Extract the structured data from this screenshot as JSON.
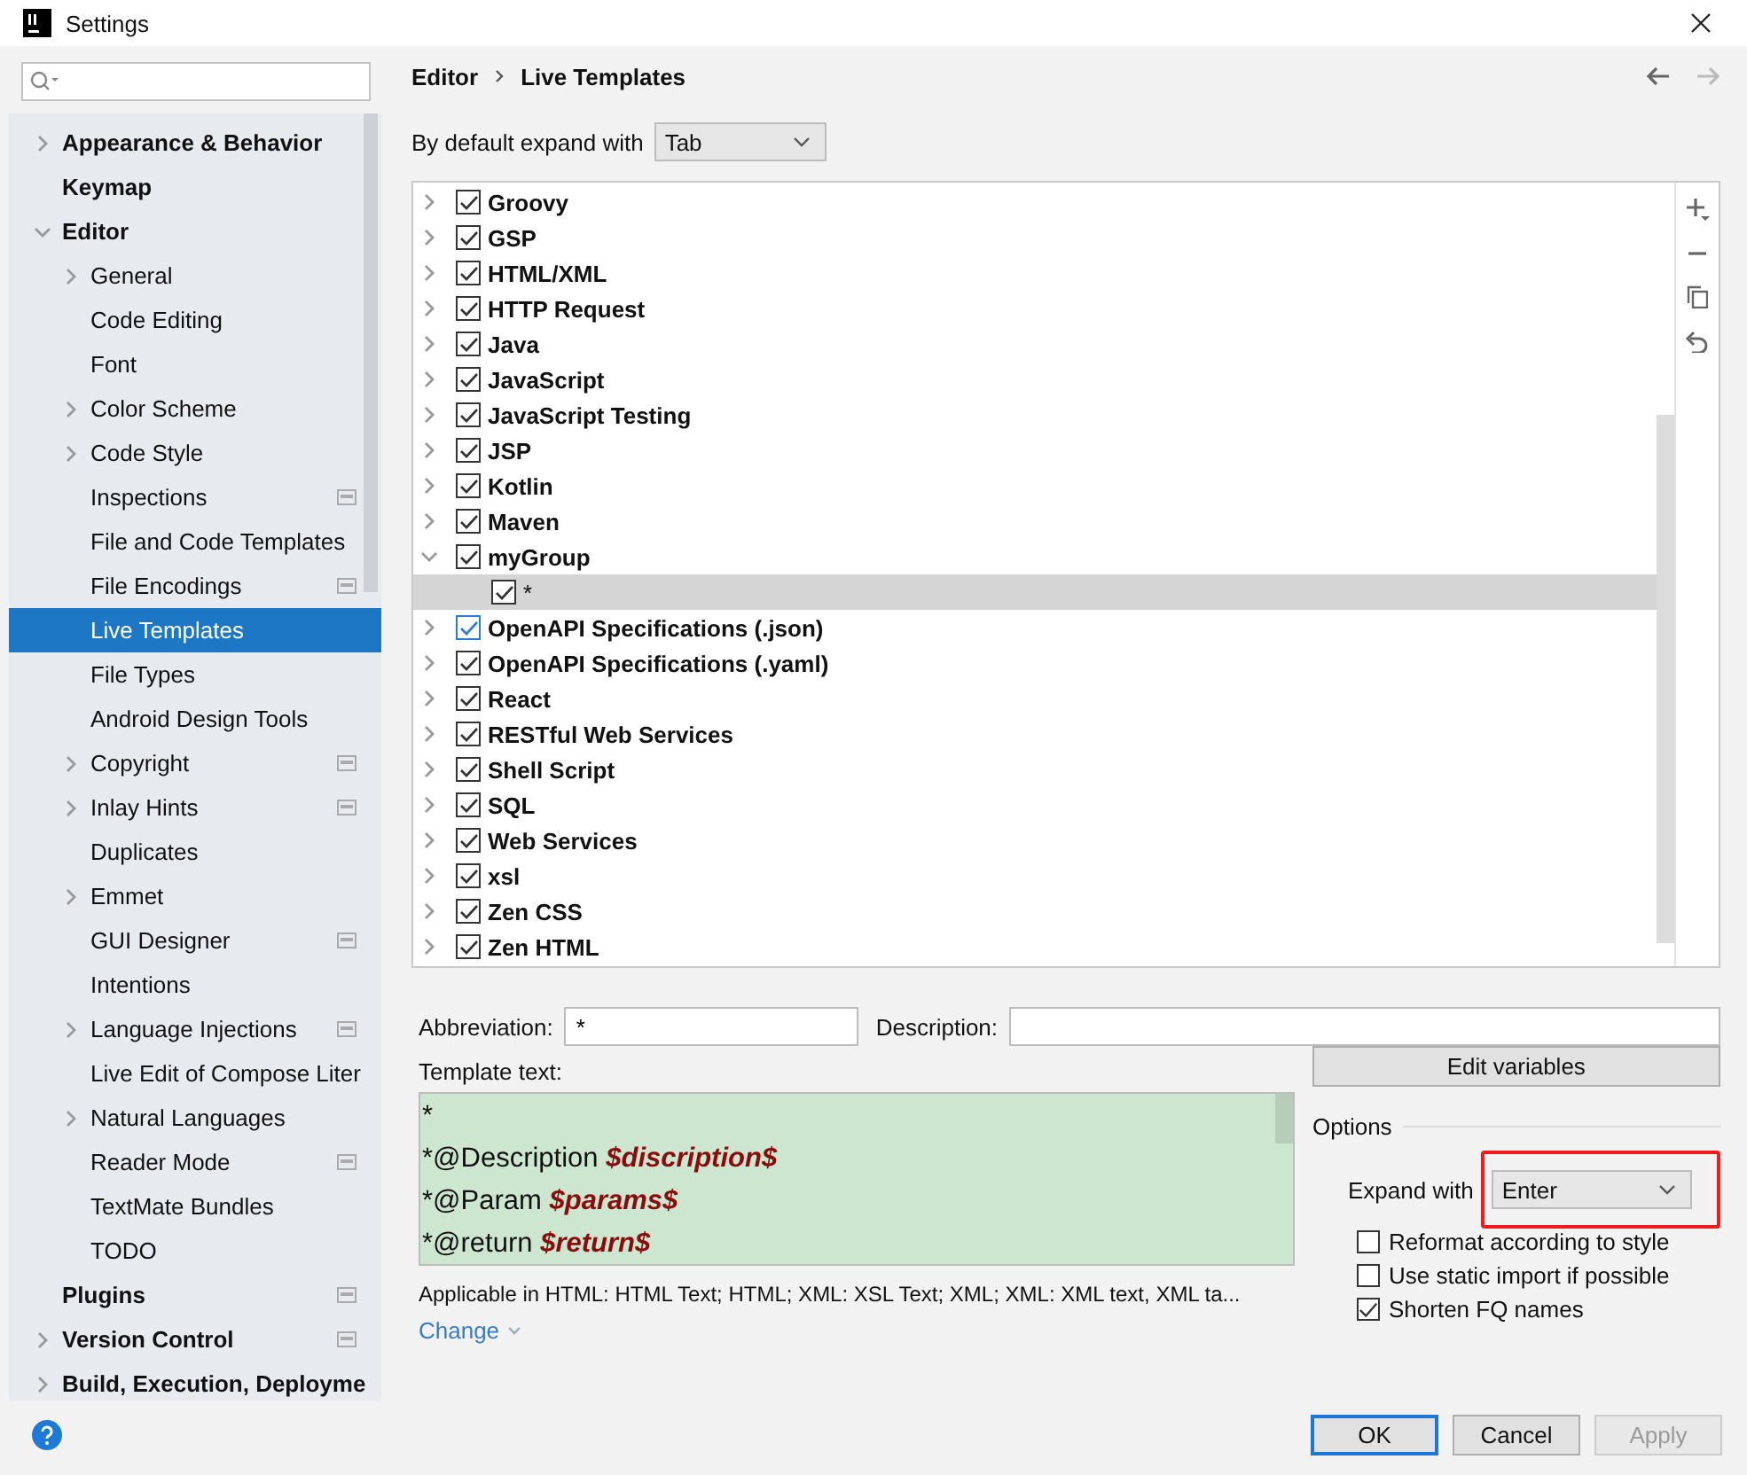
{
  "window": {
    "title": "Settings"
  },
  "sidebar": {
    "items": [
      {
        "label": "Appearance & Behavior",
        "expandable": true,
        "expanded": false,
        "selected": false,
        "project_icon": false
      },
      {
        "label": "Keymap",
        "expandable": false,
        "selected": false,
        "project_icon": false
      },
      {
        "label": "Editor",
        "expandable": true,
        "expanded": true,
        "selected": false,
        "project_icon": false,
        "children": [
          {
            "label": "General",
            "expandable": true,
            "expanded": false,
            "selected": false,
            "project_icon": false
          },
          {
            "label": "Code Editing",
            "expandable": false,
            "selected": false,
            "project_icon": false
          },
          {
            "label": "Font",
            "expandable": false,
            "selected": false,
            "project_icon": false
          },
          {
            "label": "Color Scheme",
            "expandable": true,
            "expanded": false,
            "selected": false,
            "project_icon": false
          },
          {
            "label": "Code Style",
            "expandable": true,
            "expanded": false,
            "selected": false,
            "project_icon": false
          },
          {
            "label": "Inspections",
            "expandable": false,
            "selected": false,
            "project_icon": true
          },
          {
            "label": "File and Code Templates",
            "expandable": false,
            "selected": false,
            "project_icon": false
          },
          {
            "label": "File Encodings",
            "expandable": false,
            "selected": false,
            "project_icon": true
          },
          {
            "label": "Live Templates",
            "expandable": false,
            "selected": true,
            "project_icon": false
          },
          {
            "label": "File Types",
            "expandable": false,
            "selected": false,
            "project_icon": false
          },
          {
            "label": "Android Design Tools",
            "expandable": false,
            "selected": false,
            "project_icon": false
          },
          {
            "label": "Copyright",
            "expandable": true,
            "expanded": false,
            "selected": false,
            "project_icon": true
          },
          {
            "label": "Inlay Hints",
            "expandable": true,
            "expanded": false,
            "selected": false,
            "project_icon": true
          },
          {
            "label": "Duplicates",
            "expandable": false,
            "selected": false,
            "project_icon": false
          },
          {
            "label": "Emmet",
            "expandable": true,
            "expanded": false,
            "selected": false,
            "project_icon": false
          },
          {
            "label": "GUI Designer",
            "expandable": false,
            "selected": false,
            "project_icon": true
          },
          {
            "label": "Intentions",
            "expandable": false,
            "selected": false,
            "project_icon": false
          },
          {
            "label": "Language Injections",
            "expandable": true,
            "expanded": false,
            "selected": false,
            "project_icon": true
          },
          {
            "label": "Live Edit of Compose Liter",
            "expandable": false,
            "selected": false,
            "project_icon": false
          },
          {
            "label": "Natural Languages",
            "expandable": true,
            "expanded": false,
            "selected": false,
            "project_icon": false
          },
          {
            "label": "Reader Mode",
            "expandable": false,
            "selected": false,
            "project_icon": true
          },
          {
            "label": "TextMate Bundles",
            "expandable": false,
            "selected": false,
            "project_icon": false
          },
          {
            "label": "TODO",
            "expandable": false,
            "selected": false,
            "project_icon": false
          }
        ]
      },
      {
        "label": "Plugins",
        "expandable": false,
        "selected": false,
        "project_icon": true
      },
      {
        "label": "Version Control",
        "expandable": true,
        "expanded": false,
        "selected": false,
        "project_icon": true
      },
      {
        "label": "Build, Execution, Deployme",
        "expandable": true,
        "expanded": false,
        "selected": false,
        "project_icon": false
      }
    ]
  },
  "breadcrumb": [
    "Editor",
    "Live Templates"
  ],
  "default_expand": {
    "label": "By default expand with",
    "value": "Tab"
  },
  "templates": [
    {
      "name": "Groovy",
      "checked": true,
      "expanded": false,
      "selected": false
    },
    {
      "name": "GSP",
      "checked": true,
      "expanded": false,
      "selected": false
    },
    {
      "name": "HTML/XML",
      "checked": true,
      "expanded": false,
      "selected": false
    },
    {
      "name": "HTTP Request",
      "checked": true,
      "expanded": false,
      "selected": false
    },
    {
      "name": "Java",
      "checked": true,
      "expanded": false,
      "selected": false
    },
    {
      "name": "JavaScript",
      "checked": true,
      "expanded": false,
      "selected": false
    },
    {
      "name": "JavaScript Testing",
      "checked": true,
      "expanded": false,
      "selected": false
    },
    {
      "name": "JSP",
      "checked": true,
      "expanded": false,
      "selected": false
    },
    {
      "name": "Kotlin",
      "checked": true,
      "expanded": false,
      "selected": false
    },
    {
      "name": "Maven",
      "checked": true,
      "expanded": false,
      "selected": false
    },
    {
      "name": "myGroup",
      "checked": true,
      "expanded": true,
      "selected": false,
      "children": [
        {
          "name": "*",
          "checked": true,
          "selected": true
        }
      ]
    },
    {
      "name": "OpenAPI Specifications (.json)",
      "checked": true,
      "expanded": false,
      "selected": false,
      "focused": true
    },
    {
      "name": "OpenAPI Specifications (.yaml)",
      "checked": true,
      "expanded": false,
      "selected": false
    },
    {
      "name": "React",
      "checked": true,
      "expanded": false,
      "selected": false
    },
    {
      "name": "RESTful Web Services",
      "checked": true,
      "expanded": false,
      "selected": false
    },
    {
      "name": "Shell Script",
      "checked": true,
      "expanded": false,
      "selected": false
    },
    {
      "name": "SQL",
      "checked": true,
      "expanded": false,
      "selected": false
    },
    {
      "name": "Web Services",
      "checked": true,
      "expanded": false,
      "selected": false
    },
    {
      "name": "xsl",
      "checked": true,
      "expanded": false,
      "selected": false
    },
    {
      "name": "Zen CSS",
      "checked": true,
      "expanded": false,
      "selected": false
    },
    {
      "name": "Zen HTML",
      "checked": true,
      "expanded": false,
      "selected": false
    }
  ],
  "abbreviation": {
    "label": "Abbreviation:",
    "value": "*"
  },
  "description": {
    "label": "Description:"
  },
  "template_text": {
    "label": "Template text:",
    "lines": [
      {
        "text": "*"
      },
      {
        "text": "*@Description ",
        "variable": "$discription$"
      },
      {
        "text": "*@Param ",
        "variable": "$params$"
      },
      {
        "text": "*@return ",
        "variable": "$return$"
      }
    ]
  },
  "applicable": "Applicable in HTML: HTML Text; HTML; XML: XSL Text; XML; XML: XML text, XML ta...",
  "change_link": "Change",
  "edit_variables": "Edit variables",
  "options": {
    "title": "Options",
    "expand_label": "Expand with",
    "expand_value": "Enter",
    "highlighted": true,
    "checkboxes": [
      {
        "label": "Reformat according to style",
        "checked": false
      },
      {
        "label": "Use static import if possible",
        "checked": false
      },
      {
        "label": "Shorten FQ names",
        "checked": true
      }
    ]
  },
  "buttons": [
    {
      "label": "OK",
      "kind": "default",
      "disabled": false
    },
    {
      "label": "Cancel",
      "kind": "normal",
      "disabled": false
    },
    {
      "label": "Apply",
      "kind": "normal",
      "disabled": true
    }
  ]
}
